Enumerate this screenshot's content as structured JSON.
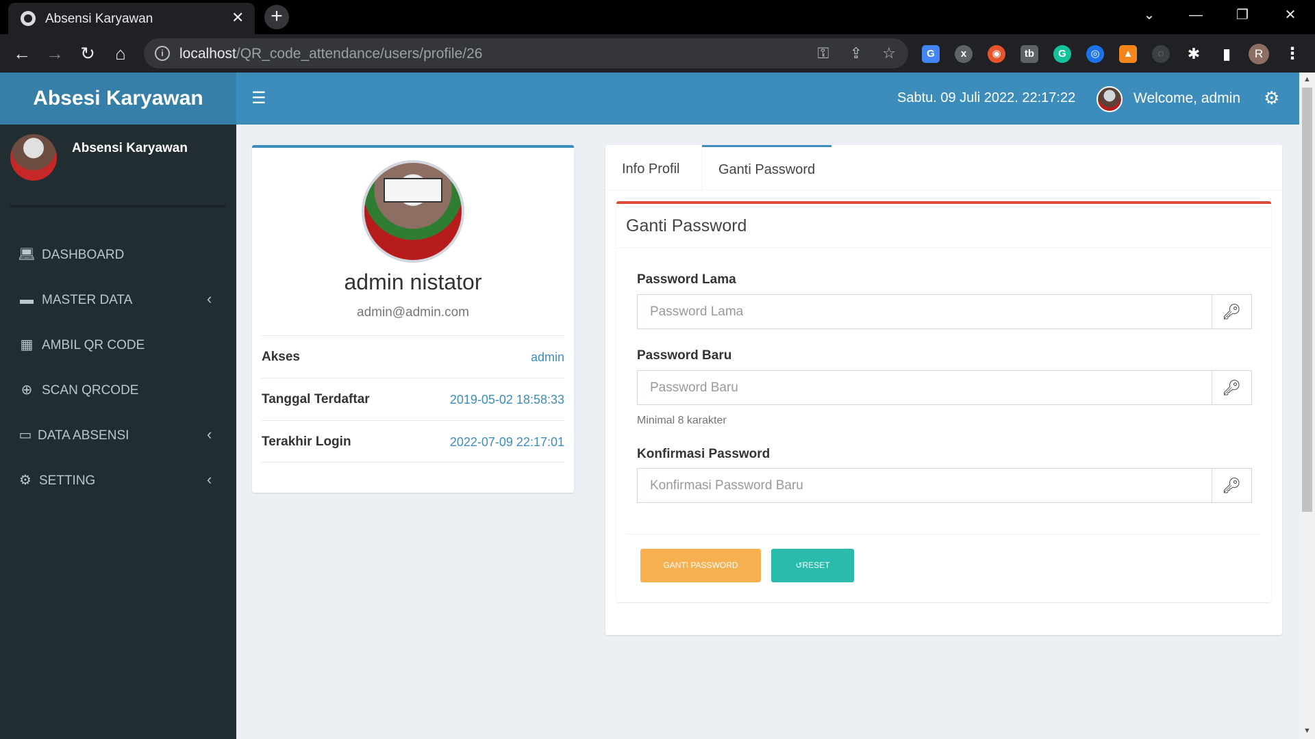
{
  "browser": {
    "tab_title": "Absensi Karyawan",
    "tab_close": "✕",
    "new_tab": "+",
    "url_host": "localhost",
    "url_path": "/QR_code_attendance/users/profile/26",
    "profile_initial": "R"
  },
  "app": {
    "brand": "Absesi Karyawan",
    "datetime": "Sabtu. 09 Juli 2022. 22:17:22",
    "welcome": "Welcome, admin"
  },
  "sidebar": {
    "user_name": "Absensi Karyawan",
    "items": [
      {
        "label": "DASHBOARD",
        "icon": "laptop-icon"
      },
      {
        "label": "MASTER DATA",
        "icon": "folder-icon",
        "has_submenu": true
      },
      {
        "label": "AMBIL QR CODE",
        "icon": "qrcode-icon"
      },
      {
        "label": "SCAN QRCODE",
        "icon": "search-plus-icon"
      },
      {
        "label": "DATA ABSENSI",
        "icon": "folder-open-icon",
        "has_submenu": true
      },
      {
        "label": "SETTING",
        "icon": "gears-icon",
        "has_submenu": true
      }
    ]
  },
  "profile": {
    "name": "admin nistator",
    "email": "admin@admin.com",
    "rows": [
      {
        "key": "Akses",
        "value": "admin"
      },
      {
        "key": "Tanggal Terdaftar",
        "value": "2019-05-02 18:58:33"
      },
      {
        "key": "Terakhir Login",
        "value": "2022-07-09 22:17:01"
      }
    ]
  },
  "tabs": [
    {
      "label": "Info Profil",
      "active": false
    },
    {
      "label": "Ganti Password",
      "active": true
    }
  ],
  "password_form": {
    "title": "Ganti Password",
    "old_label": "Password Lama",
    "old_placeholder": "Password Lama",
    "new_label": "Password Baru",
    "new_placeholder": "Password Baru",
    "new_help": "Minimal 8 karakter",
    "confirm_label": "Konfirmasi Password",
    "confirm_placeholder": "Konfirmasi Password Baru",
    "submit_label": "GANTI PASSWORD",
    "reset_label": "RESET"
  },
  "colors": {
    "header": "#3c8dbc",
    "brand": "#367fa9",
    "sidebar": "#222d32",
    "danger_accent": "#dd4b39",
    "warning_button": "#f7b050",
    "success_button": "#2bbbad"
  }
}
